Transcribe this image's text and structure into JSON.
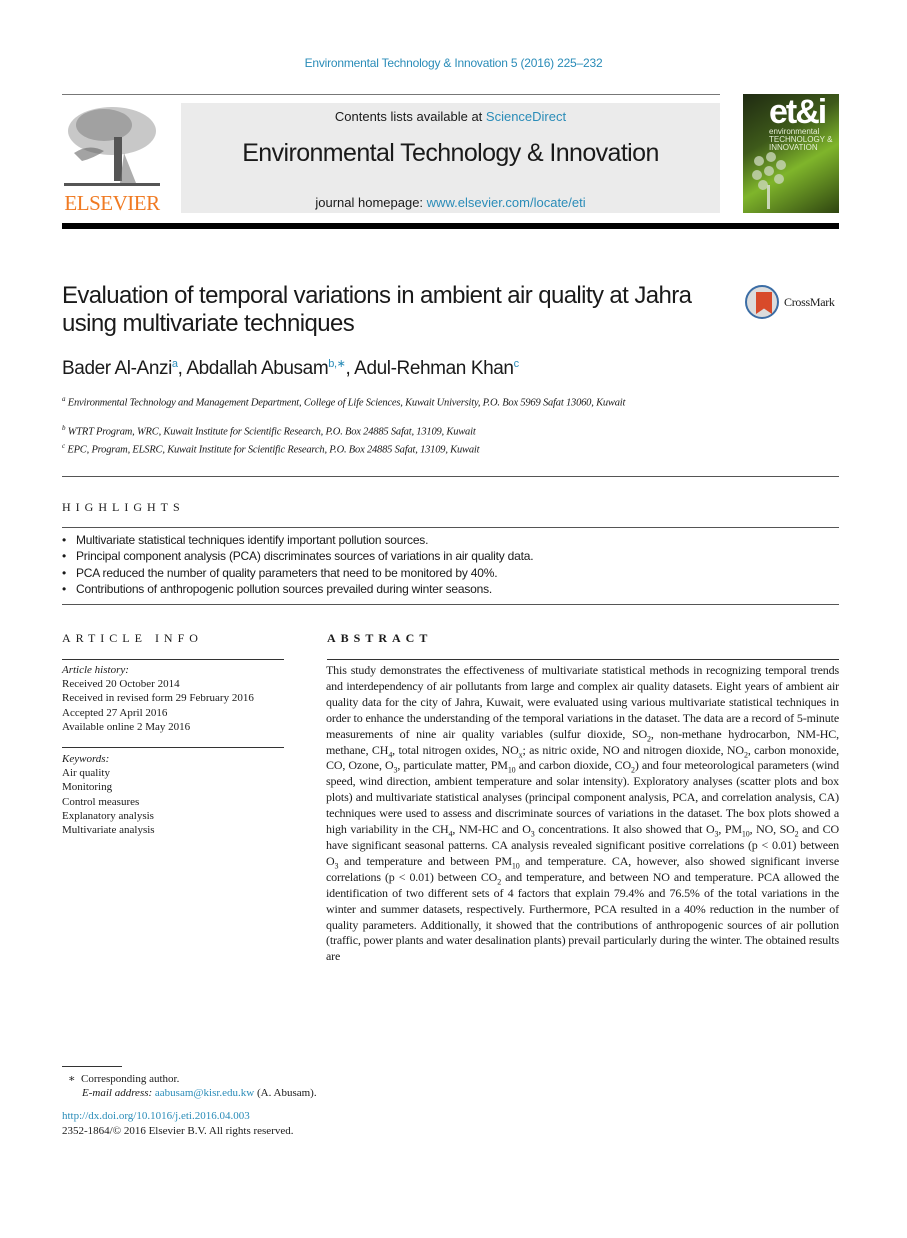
{
  "journal_reference": "Environmental Technology & Innovation 5 (2016) 225–232",
  "banner": {
    "contents_prefix": "Contents lists available at ",
    "contents_link": "ScienceDirect",
    "journal_title": "Environmental Technology & Innovation",
    "homepage_prefix": "journal homepage: ",
    "homepage_link": "www.elsevier.com/locate/eti"
  },
  "publisher_logo": {
    "wordmark": "ELSEVIER",
    "color": "#f07a22"
  },
  "cover": {
    "mark": "et&i",
    "line1": "environmental",
    "line2": "TECHNOLOGY &",
    "line3": "INNOVATION"
  },
  "crossmark_label": "CrossMark",
  "title": "Evaluation of temporal variations in ambient air quality at Jahra using multivariate techniques",
  "authors": [
    {
      "name": "Bader Al-Anzi",
      "sup": "a"
    },
    {
      "name": "Abdallah Abusam",
      "sup": "b,∗"
    },
    {
      "name": "Adul-Rehman Khan",
      "sup": "c"
    }
  ],
  "affiliations": [
    {
      "key": "a",
      "text": "Environmental Technology and Management Department, College of Life Sciences, Kuwait University, P.O. Box 5969 Safat 13060, Kuwait"
    },
    {
      "key": "b",
      "text": "WTRT Program, WRC, Kuwait Institute for Scientific Research, P.O. Box 24885 Safat, 13109, Kuwait"
    },
    {
      "key": "c",
      "text": "EPC, Program, ELSRC, Kuwait Institute for Scientific Research, P.O. Box 24885 Safat, 13109, Kuwait"
    }
  ],
  "highlights": {
    "heading": "HIGHLIGHTS",
    "items": [
      "Multivariate statistical techniques identify important pollution sources.",
      "Principal component analysis (PCA) discriminates sources of variations in air quality data.",
      "PCA reduced the number of quality parameters that need to be monitored by 40%.",
      "Contributions of anthropogenic pollution sources prevailed during winter seasons."
    ]
  },
  "article_info": {
    "heading": "ARTICLE INFO",
    "history_label": "Article history:",
    "history": [
      "Received 20 October 2014",
      "Received in revised form 29 February 2016",
      "Accepted 27 April 2016",
      "Available online 2 May 2016"
    ],
    "keywords_label": "Keywords:",
    "keywords": [
      "Air quality",
      "Monitoring",
      "Control measures",
      "Explanatory analysis",
      "Multivariate analysis"
    ]
  },
  "abstract": {
    "heading": "ABSTRACT",
    "segments": [
      "This study demonstrates the effectiveness of multivariate statistical methods in recognizing temporal trends and interdependency of air pollutants from large and complex air quality datasets. Eight years of ambient air quality data for the city of Jahra, Kuwait, were evaluated using various multivariate statistical techniques in order to enhance the understanding of the temporal variations in the dataset. The data are a record of 5-minute measurements of nine air quality variables (sulfur dioxide, SO",
      "2",
      ", non-methane hydrocarbon, NM-HC, methane, CH",
      "4",
      ", total nitrogen oxides, NO",
      "x",
      "; as nitric oxide, NO and nitrogen dioxide, NO",
      "2",
      ", carbon monoxide, CO, Ozone, O",
      "3",
      ", particulate matter, PM",
      "10",
      " and carbon dioxide, CO",
      "2",
      ") and four meteorological parameters (wind speed, wind direction, ambient temperature and solar intensity). Exploratory analyses (scatter plots and box plots) and multivariate statistical analyses (principal component analysis, PCA, and correlation analysis, CA) techniques were used to assess and discriminate sources of variations in the dataset. The box plots showed a high variability in the CH",
      "4",
      ", NM-HC and O",
      "3",
      " concentrations. It also showed that O",
      "3",
      ", PM",
      "10",
      ", NO, SO",
      "2",
      " and CO have significant seasonal patterns. CA analysis revealed significant positive correlations (p < 0.01) between O",
      "3",
      " and temperature and between PM",
      "10",
      " and temperature. CA, however, also showed significant inverse correlations (p < 0.01) between CO",
      "2",
      " and temperature, and between NO and temperature. PCA allowed the identification of two different sets of 4 factors that explain 79.4% and 76.5% of the total variations in the winter and summer datasets, respectively. Furthermore, PCA resulted in a 40% reduction in the number of quality parameters. Additionally, it showed that the contributions of anthropogenic sources of air pollution (traffic, power plants and water desalination plants) prevail particularly during the winter. The obtained results are"
    ]
  },
  "footnote": {
    "marker": "∗",
    "corresponding": "Corresponding author.",
    "email_label": "E-mail address: ",
    "email": "aabusam@kisr.edu.kw",
    "email_suffix": " (A. Abusam)."
  },
  "doi": "http://dx.doi.org/10.1016/j.eti.2016.04.003",
  "copyright": "2352-1864/© 2016 Elsevier B.V. All rights reserved."
}
